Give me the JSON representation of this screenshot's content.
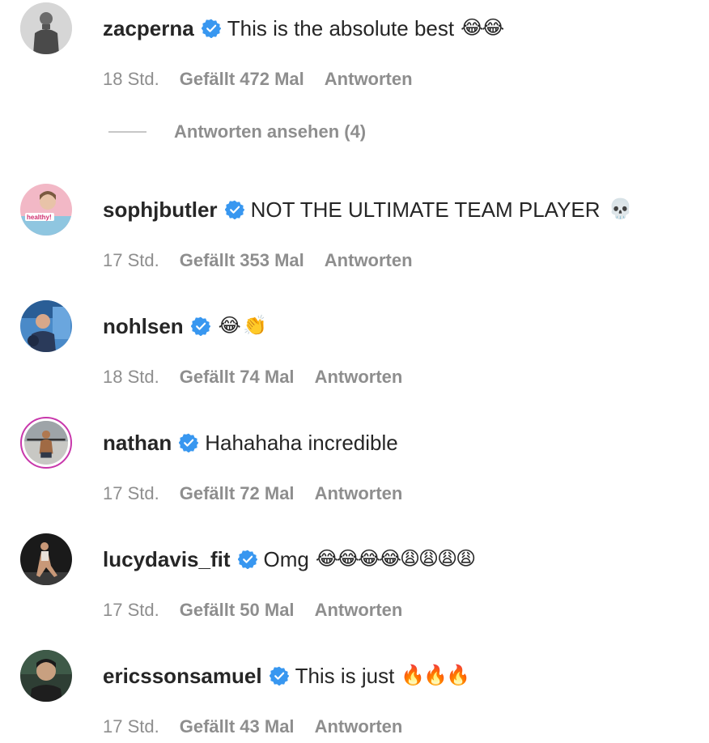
{
  "comments": [
    {
      "username": "zacperna",
      "text": "This is the absolute best",
      "emoji": "😂😂",
      "time": "18 Std.",
      "likes": "Gefällt 472 Mal",
      "reply": "Antworten",
      "view_replies": "Antworten ansehen (4)"
    },
    {
      "username": "sophjbutler",
      "text": "NOT THE ULTIMATE TEAM PLAYER",
      "emoji": "💀",
      "time": "17 Std.",
      "likes": "Gefällt 353 Mal",
      "reply": "Antworten",
      "avatar_text": "healthy!"
    },
    {
      "username": "nohlsen",
      "text": "",
      "emoji": "😂 👏",
      "time": "18 Std.",
      "likes": "Gefällt 74 Mal",
      "reply": "Antworten"
    },
    {
      "username": "nathan",
      "text": "Hahahaha incredible",
      "emoji": "",
      "time": "17 Std.",
      "likes": "Gefällt 72 Mal",
      "reply": "Antworten"
    },
    {
      "username": "lucydavis_fit",
      "text": "Omg",
      "emoji": "😂😂😂😂😩😩😩😩",
      "time": "17 Std.",
      "likes": "Gefällt 50 Mal",
      "reply": "Antworten"
    },
    {
      "username": "ericssonsamuel",
      "text": "This is just",
      "emoji": "🔥🔥🔥",
      "time": "17 Std.",
      "likes": "Gefällt 43 Mal",
      "reply": "Antworten"
    }
  ],
  "colors": {
    "verified": "#3897f0",
    "meta": "#8e8e8e",
    "text": "#262626",
    "story_ring": "#c837ab"
  },
  "icons": {
    "verified": "verified-badge-icon"
  }
}
